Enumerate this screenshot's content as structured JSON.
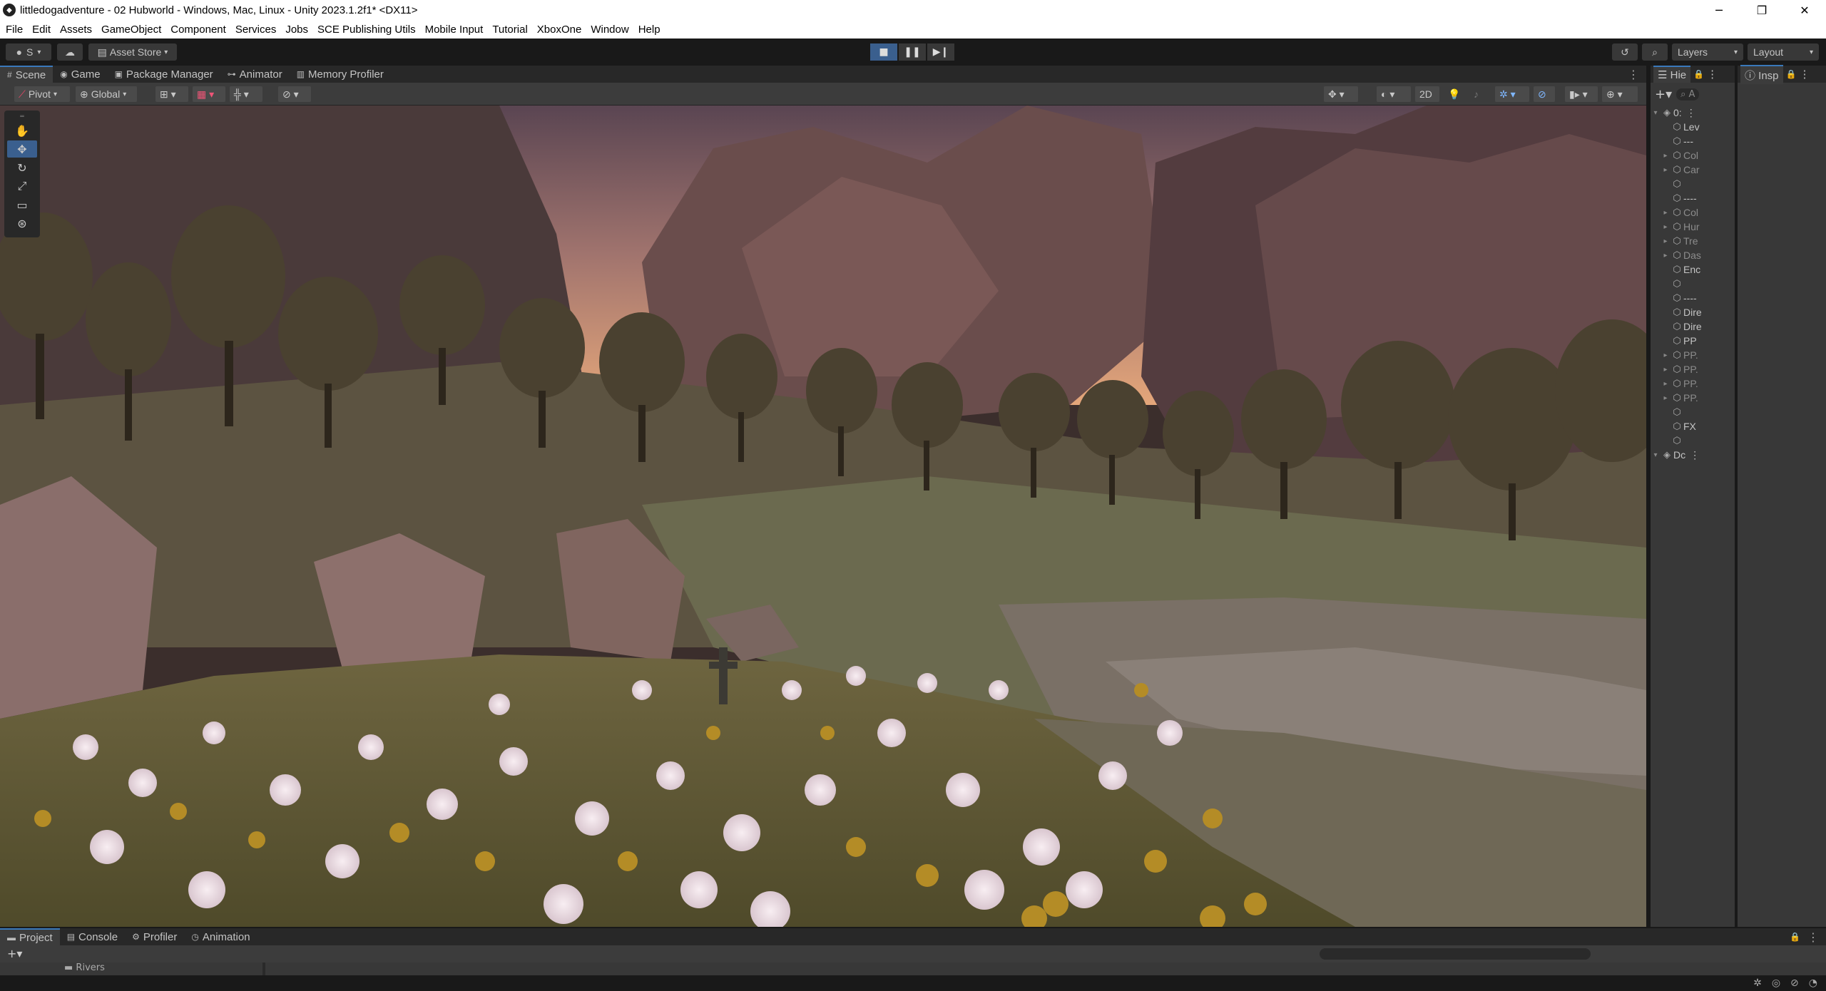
{
  "window": {
    "title": "littledogadventure - 02 Hubworld - Windows, Mac, Linux - Unity 2023.1.2f1* <DX11>",
    "controls": [
      "─",
      "❐",
      "✕"
    ]
  },
  "menu": [
    "File",
    "Edit",
    "Assets",
    "GameObject",
    "Component",
    "Services",
    "Jobs",
    "SCE Publishing Utils",
    "Mobile Input",
    "Tutorial",
    "XboxOne",
    "Window",
    "Help"
  ],
  "toolbar": {
    "account": "S",
    "asset_store": "Asset Store",
    "layers": "Layers",
    "layout": "Layout"
  },
  "scene_tabs": [
    {
      "label": "Scene",
      "icon": "scene-icon",
      "active": true
    },
    {
      "label": "Game",
      "icon": "game-icon",
      "active": false
    },
    {
      "label": "Package Manager",
      "icon": "package-icon",
      "active": false
    },
    {
      "label": "Animator",
      "icon": "animator-icon",
      "active": false
    },
    {
      "label": "Memory Profiler",
      "icon": "memory-icon",
      "active": false
    }
  ],
  "scene_toolbar": {
    "pivot": "Pivot",
    "global": "Global",
    "mode_2d": "2D"
  },
  "hierarchy": {
    "tab": "Hie",
    "search_placeholder": "A",
    "rows": [
      {
        "label": "0:",
        "type": "scene"
      },
      {
        "label": "Lev",
        "type": "obj"
      },
      {
        "label": "---",
        "type": "obj"
      },
      {
        "label": "Col",
        "type": "obj",
        "dim": true
      },
      {
        "label": "Car",
        "type": "obj",
        "dim": true
      },
      {
        "label": "",
        "type": "obj"
      },
      {
        "label": "----",
        "type": "obj"
      },
      {
        "label": "Col",
        "type": "obj",
        "dim": true
      },
      {
        "label": "Hur",
        "type": "obj",
        "dim": true
      },
      {
        "label": "Tre",
        "type": "obj",
        "dim": true
      },
      {
        "label": "Das",
        "type": "obj",
        "dim": true
      },
      {
        "label": "Enc",
        "type": "obj"
      },
      {
        "label": "",
        "type": "obj"
      },
      {
        "label": "----",
        "type": "obj"
      },
      {
        "label": "Dire",
        "type": "obj"
      },
      {
        "label": "Dire",
        "type": "obj"
      },
      {
        "label": "PP",
        "type": "obj"
      },
      {
        "label": "PP.",
        "type": "obj",
        "dim": true
      },
      {
        "label": "PP.",
        "type": "obj",
        "dim": true
      },
      {
        "label": "PP.",
        "type": "obj",
        "dim": true
      },
      {
        "label": "PP.",
        "type": "obj",
        "dim": true
      },
      {
        "label": "",
        "type": "obj"
      },
      {
        "label": "FX",
        "type": "obj"
      },
      {
        "label": "",
        "type": "obj"
      },
      {
        "label": "Dc",
        "type": "scene"
      }
    ]
  },
  "inspector": {
    "tab": "Insp"
  },
  "bottom_tabs": [
    {
      "label": "Project",
      "icon": "folder-icon",
      "active": true
    },
    {
      "label": "Console",
      "icon": "console-icon",
      "active": false
    },
    {
      "label": "Profiler",
      "icon": "profiler-icon",
      "active": false
    },
    {
      "label": "Animation",
      "icon": "animation-icon",
      "active": false
    }
  ],
  "bottom": {
    "folder": "Rivers"
  }
}
